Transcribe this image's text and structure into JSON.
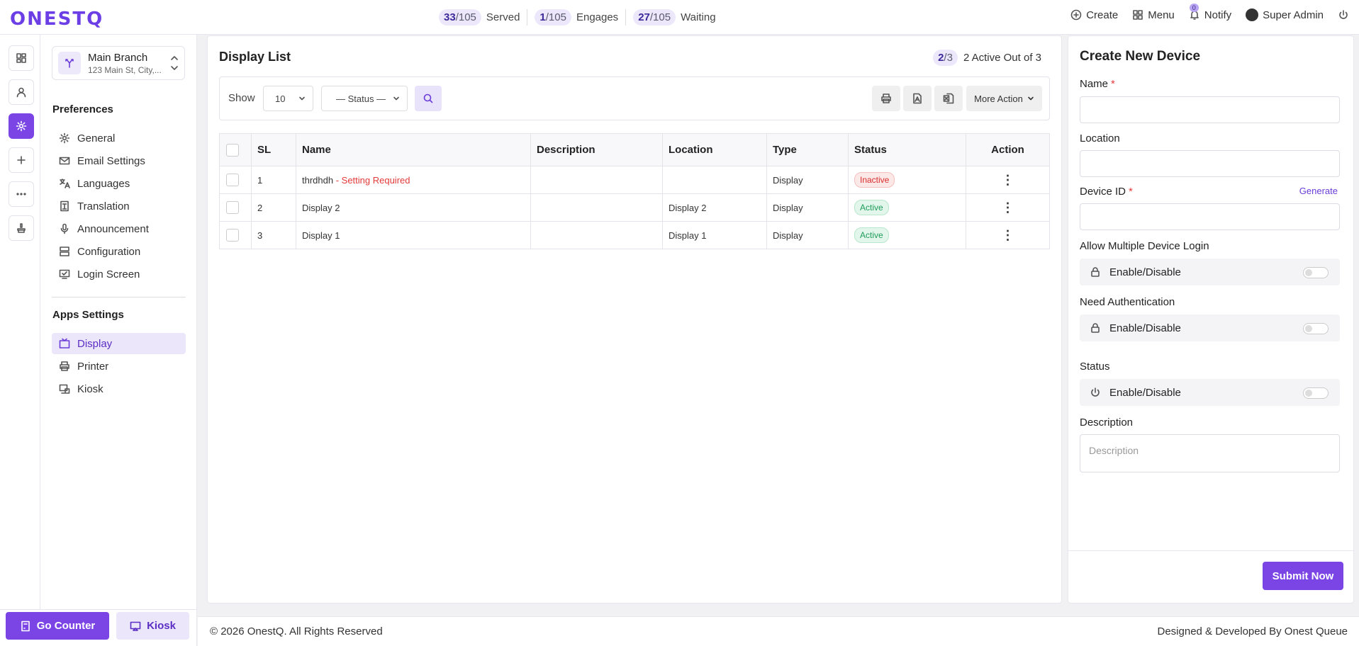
{
  "brand": {
    "logo_text": "ONESTQ",
    "accent": "#7b45e6"
  },
  "topbar": {
    "stats": [
      {
        "count": "33",
        "total": "/105",
        "label": "Served"
      },
      {
        "count": "1",
        "total": "/105",
        "label": "Engages"
      },
      {
        "count": "27",
        "total": "/105",
        "label": "Waiting"
      }
    ],
    "create": "Create",
    "menu": "Menu",
    "notify": "Notify",
    "notify_count": "0",
    "user": "Super Admin"
  },
  "branch": {
    "name": "Main Branch",
    "address": "123 Main St, City,..."
  },
  "sidebar": {
    "preferences_title": "Preferences",
    "preferences": [
      {
        "label": "General",
        "icon": "gear-icon"
      },
      {
        "label": "Email Settings",
        "icon": "mail-icon"
      },
      {
        "label": "Languages",
        "icon": "translate-icon"
      },
      {
        "label": "Translation",
        "icon": "document-icon"
      },
      {
        "label": "Announcement",
        "icon": "microphone-icon"
      },
      {
        "label": "Configuration",
        "icon": "server-icon"
      },
      {
        "label": "Login Screen",
        "icon": "monitor-icon"
      }
    ],
    "apps_title": "Apps Settings",
    "apps": [
      {
        "label": "Display",
        "icon": "tv-icon",
        "active": true
      },
      {
        "label": "Printer",
        "icon": "printer-icon"
      },
      {
        "label": "Kiosk",
        "icon": "kiosk-icon"
      }
    ],
    "go_counter": "Go Counter",
    "kiosk_btn": "Kiosk"
  },
  "main": {
    "title": "Display List",
    "active_ratio_num": "2",
    "active_ratio_den": "/3",
    "active_text": "2 Active Out of 3",
    "show_label": "Show",
    "page_size": "10",
    "status_filter": "— Status —",
    "more_action": "More Action",
    "columns": [
      "SL",
      "Name",
      "Description",
      "Location",
      "Type",
      "Status",
      "Action"
    ],
    "rows": [
      {
        "sl": "1",
        "name": "thrdhdh",
        "warning": " - Setting Required",
        "description": "",
        "location": "",
        "type": "Display",
        "status": "Inactive"
      },
      {
        "sl": "2",
        "name": "Display 2",
        "warning": "",
        "description": "",
        "location": "Display 2",
        "type": "Display",
        "status": "Active"
      },
      {
        "sl": "3",
        "name": "Display 1",
        "warning": "",
        "description": "",
        "location": "Display 1",
        "type": "Display",
        "status": "Active"
      }
    ],
    "action_glyph": "⋮"
  },
  "form": {
    "title": "Create New Device",
    "name_label": "Name",
    "location_label": "Location",
    "device_id_label": "Device ID",
    "generate": "Generate",
    "required_mark": "*",
    "multi_login_label": "Allow Multiple Device Login",
    "auth_label": "Need Authentication",
    "status_label": "Status",
    "toggle_text": "Enable/Disable",
    "description_label": "Description",
    "description_placeholder": "Description",
    "submit": "Submit Now"
  },
  "footer": {
    "copyright": "© 2026 OnestQ. All Rights Reserved",
    "credit": "Designed & Developed By Onest Queue"
  }
}
